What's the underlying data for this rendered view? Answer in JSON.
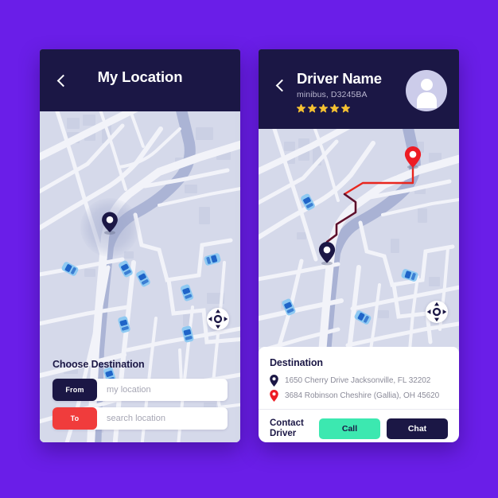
{
  "theme": {
    "background": "#6a1ee8",
    "navy": "#1b1745",
    "red": "#f03c3c",
    "mint": "#3ce8b0",
    "map_base": "#d5d9ea",
    "road": "#f2f3f9",
    "water": "#a9b2d4",
    "car_body": "#8ec9f2",
    "car_window": "#1f64c8",
    "star_gold": "#f5c132",
    "avatar_bg": "#ccccea",
    "muted_text": "#8b8b99"
  },
  "screen_left": {
    "header": {
      "back_icon": "chevron-left-icon",
      "title": "My Location"
    },
    "map": {
      "locate_icon": "crosshair-locate-icon",
      "pin_icon": "map-pin-navy-icon"
    },
    "destination_panel": {
      "title": "Choose Destination",
      "fields": [
        {
          "tag": "From",
          "tag_color": "#1b1745",
          "value": "",
          "placeholder": "my location"
        },
        {
          "tag": "To",
          "tag_color": "#f03c3c",
          "value": "",
          "placeholder": "search location"
        }
      ]
    }
  },
  "screen_right": {
    "header": {
      "back_icon": "chevron-left-icon",
      "driver_name": "Driver Name",
      "vehicle_info": "minibus, D3245BA",
      "rating": 5,
      "rating_max": 5,
      "avatar_icon": "user-avatar-icon"
    },
    "map": {
      "locate_icon": "crosshair-locate-icon",
      "origin_pin_icon": "map-pin-navy-icon",
      "destination_pin_icon": "map-pin-red-icon",
      "route_color": "#e8261e"
    },
    "info_card": {
      "title": "Destination",
      "addresses": [
        {
          "pin_icon": "map-pin-navy-icon",
          "pin_color": "#1b1745",
          "text": "1650 Cherry Drive Jacksonville, FL 32202"
        },
        {
          "pin_icon": "map-pin-red-icon",
          "pin_color": "#e8261e",
          "text": "3684 Robinson Cheshire (Gallia), OH 45620"
        }
      ],
      "contact_label": "Contact Driver",
      "buttons": [
        {
          "label": "Call",
          "style": "mint"
        },
        {
          "label": "Chat",
          "style": "navy"
        }
      ]
    }
  }
}
